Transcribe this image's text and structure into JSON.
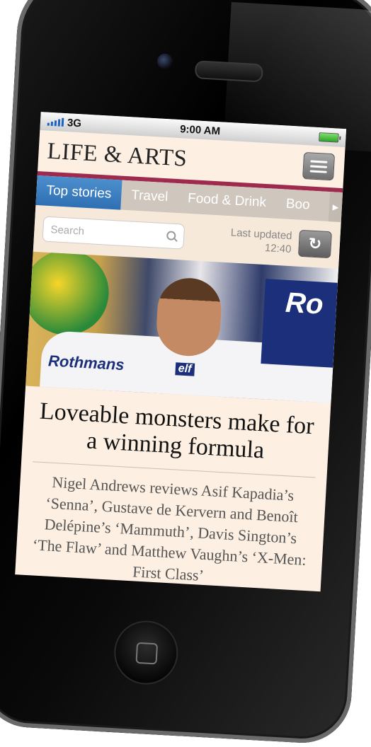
{
  "status_bar": {
    "carrier": "3G",
    "time": "9:00 AM"
  },
  "masthead": {
    "title": "LIFE & ARTS"
  },
  "tabs": [
    {
      "label": "Top stories",
      "active": true
    },
    {
      "label": "Travel"
    },
    {
      "label": "Food & Drink"
    },
    {
      "label": "Boo"
    }
  ],
  "search": {
    "placeholder": "Search"
  },
  "last_updated": {
    "label": "Last updated",
    "time": "12:40"
  },
  "photo": {
    "livery_1": "Rothmans",
    "livery_2": "elf",
    "livery_3": "Ro"
  },
  "article": {
    "headline": "Loveable monsters make for a winning formula",
    "standfirst": "Nigel Andrews reviews Asif Kapadia’s ‘Senna’, Gustave de Kervern and Benoît Delépine’s ‘Mammuth’, Davis Sington’s ‘The Flaw’ and Matthew Vaughn’s ‘X-Men: First Class’"
  },
  "colors": {
    "accent_bar": "#9e2a4e",
    "active_tab": "#2f6fb3",
    "page_bg": "#fdf0e2"
  }
}
